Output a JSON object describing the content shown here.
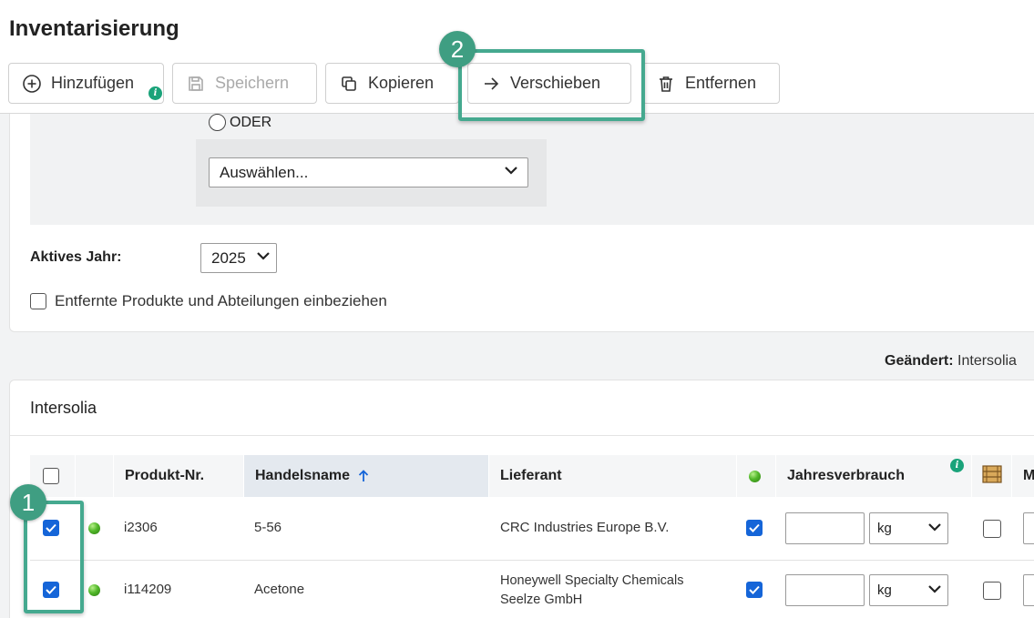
{
  "page": {
    "title": "Inventarisierung"
  },
  "toolbar": {
    "add_label": "Hinzufügen",
    "save_label": "Speichern",
    "copy_label": "Kopieren",
    "move_label": "Verschieben",
    "remove_label": "Entfernen"
  },
  "annotations": {
    "step1": "1",
    "step2": "2"
  },
  "filter": {
    "radio_label": "ODER",
    "select_value": "Auswählen...",
    "year_label": "Aktives Jahr:",
    "year_value": "2025",
    "include_removed_label": "Entfernte Produkte und Abteilungen einbeziehen"
  },
  "changed": {
    "label": "Geändert:",
    "value": "Intersolia"
  },
  "list": {
    "title": "Intersolia",
    "columns": {
      "product_no": "Produkt-Nr.",
      "trade_name": "Handelsname",
      "supplier": "Lieferant",
      "annual_consumption": "Jahresverbrauch",
      "next": "M"
    },
    "rows": [
      {
        "product_no": "i2306",
        "trade_name": "5-56",
        "supplier_line1": "CRC Industries Europe B.V.",
        "supplier_line2": "",
        "unit": "kg"
      },
      {
        "product_no": "i114209",
        "trade_name": "Acetone",
        "supplier_line1": "Honeywell Specialty Chemicals",
        "supplier_line2": "Seelze GmbH",
        "unit": "kg"
      }
    ]
  },
  "icons": {
    "add": "plus-circle-icon",
    "save": "floppy-disk-icon",
    "copy": "copy-icon",
    "move": "arrow-right-icon",
    "remove": "trash-icon",
    "status": "green-dot-icon",
    "storage": "crate-icon"
  },
  "colors": {
    "accent": "#45a98f",
    "checkbox": "#1565d8",
    "info": "#1aa37a"
  }
}
